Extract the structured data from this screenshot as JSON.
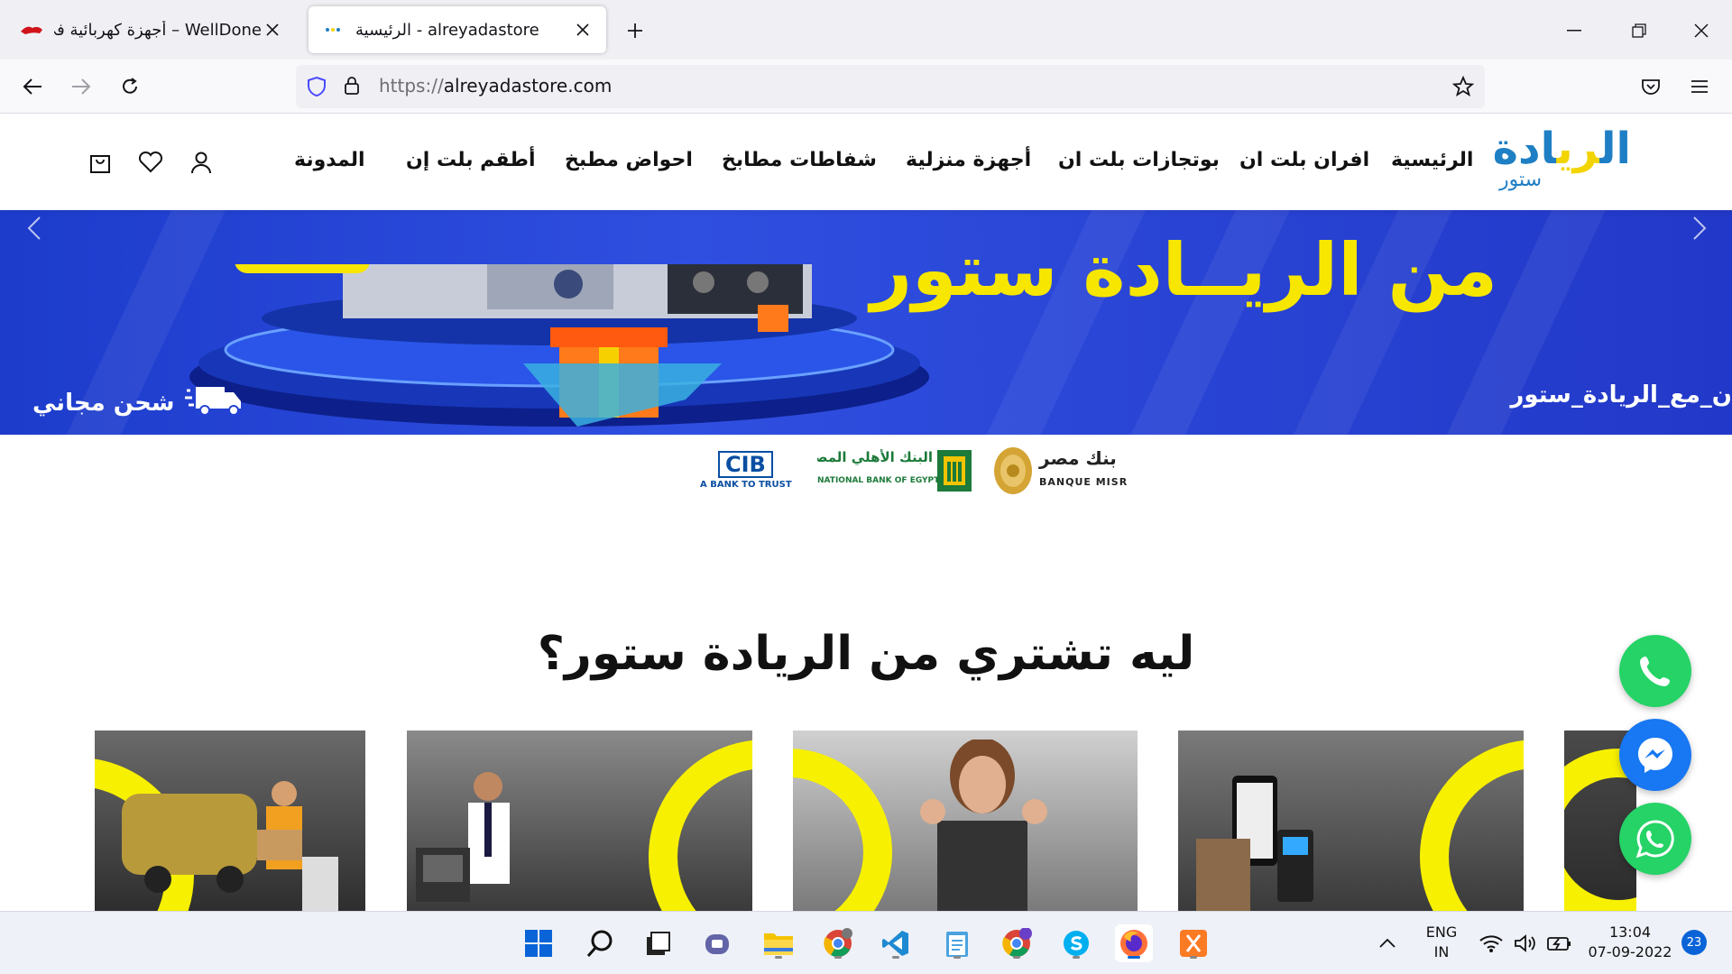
{
  "browser": {
    "tabs": [
      {
        "title": "WellDone – أجهزة كهربائية في مصر",
        "active": false
      },
      {
        "title": "الرئيسية - alreyadastore",
        "active": true
      }
    ],
    "url_protocol": "https://",
    "url_host": "alreyadastore.com"
  },
  "site": {
    "logo_main": "الريادة",
    "logo_sub": "ستور",
    "menu": [
      "الرئيسية",
      "افران بلت ان",
      "بوتجازات بلت ان",
      "أجهزة منزلية",
      "شفاطات مطابخ",
      "احواض مطبخ",
      "أطقم بلت إن",
      "المدونة"
    ]
  },
  "hero": {
    "title": "من الريــادة ستور",
    "hashtag": "ن_مع_الريادة_ستور",
    "shipping": "شحن مجاني"
  },
  "banks": {
    "cib_logo": "CIB",
    "cib_slogan": "A BANK TO TRUST",
    "nbe_ar": "البنك الأهلي المصري",
    "nbe_en": "NATIONAL BANK OF EGYPT",
    "misr_ar": "بنك مصر",
    "misr_en": "BANQUE MISR"
  },
  "section": {
    "why_title": "ليه تشتري من الريادة ستور؟"
  },
  "taskbar": {
    "lang_top": "ENG",
    "lang_bottom": "IN",
    "time": "13:04",
    "date": "07-09-2022",
    "notifications": "23"
  },
  "colors": {
    "brand_blue": "#1e7fc4",
    "brand_yellow": "#f7e600",
    "hero_blue": "#2443d4",
    "phone_green": "#25d366",
    "messenger_blue": "#1877f2"
  }
}
